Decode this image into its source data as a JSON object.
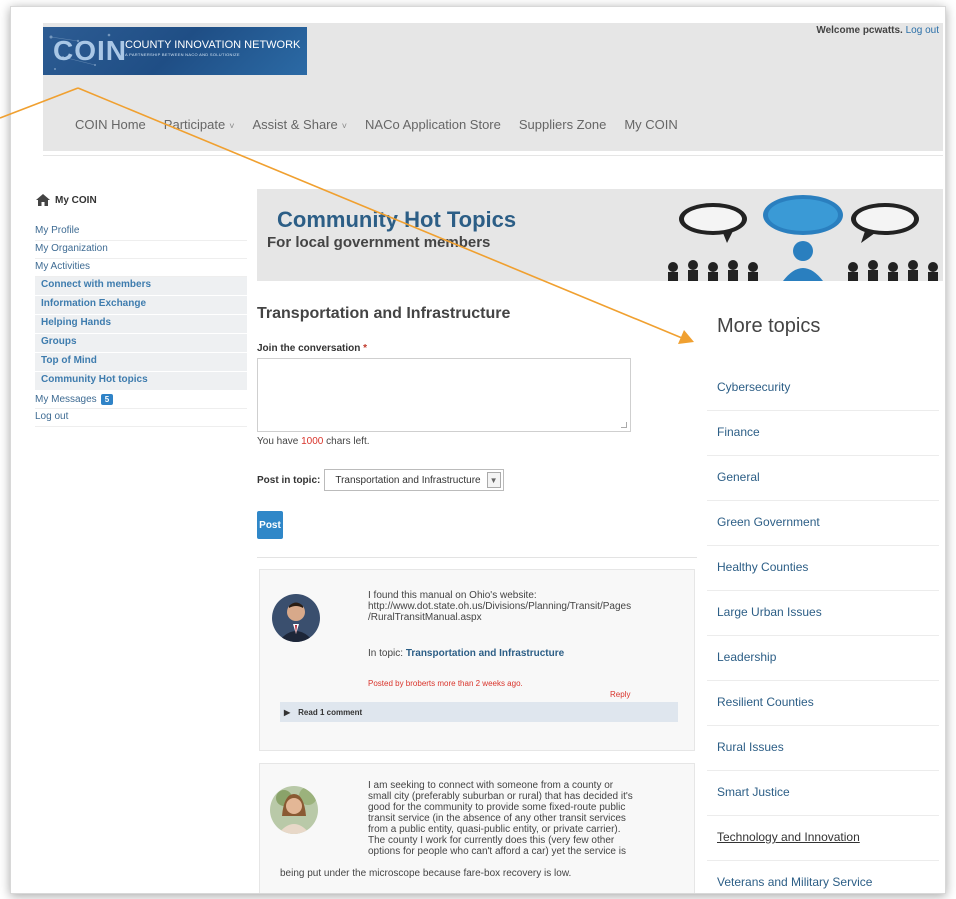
{
  "header": {
    "logo_text": "COIN",
    "logo_subtitle": "COUNTY INNOVATION NETWORK",
    "logo_tagline": "A PARTNERSHIP BETWEEN NACO AND SOLUTIONIZE",
    "welcome_text": "Welcome pcwatts.",
    "logout_link": "Log out"
  },
  "nav": {
    "items": [
      {
        "label": "COIN Home",
        "caret": false
      },
      {
        "label": "Participate",
        "caret": true
      },
      {
        "label": "Assist & Share",
        "caret": true
      },
      {
        "label": "NACo Application Store",
        "caret": false
      },
      {
        "label": "Suppliers Zone",
        "caret": false
      },
      {
        "label": "My COIN",
        "caret": false
      }
    ],
    "caret_glyph": "˅"
  },
  "sidebar": {
    "title": "My COIN",
    "links": [
      "My Profile",
      "My Organization",
      "My Activities"
    ],
    "activities": [
      "Connect with members",
      "Information Exchange",
      "Helping Hands",
      "Groups",
      "Top of Mind",
      "Community Hot topics"
    ],
    "messages_label": "My Messages",
    "messages_count": "5",
    "logout": "Log out"
  },
  "banner": {
    "title": "Community Hot Topics",
    "subtitle": "For local government members"
  },
  "main": {
    "topic_title": "Transportation and Infrastructure",
    "join_label": "Join the conversation",
    "required_mark": "*",
    "chars_prefix": "You have",
    "chars_count": "1000",
    "chars_suffix": "chars left.",
    "post_in_label": "Post in topic:",
    "post_in_value": "Transportation and Infrastructure",
    "post_button": "Post"
  },
  "posts": [
    {
      "line1": "I found this manual on Ohio's website:",
      "line2": "http://www.dot.state.oh.us/Divisions/Planning/Transit/Pages",
      "line3": "/RuralTransitManual.aspx",
      "in_topic_prefix": "In topic:",
      "in_topic": "Transportation and Infrastructure",
      "posted": "Posted by broberts more than 2 weeks ago.",
      "reply": "Reply",
      "read_comments": "Read 1 comment"
    },
    {
      "lines": [
        "I am seeking to connect with someone from a county or",
        "small city (preferably suburban or rural) that has decided it's",
        "good for the community to provide some fixed-route public",
        "transit service (in the absence of any other transit services",
        "from a public entity, quasi-public entity, or private carrier).",
        "The county I work for currently does this (very few other",
        "options for people who can't afford a car) yet the service is"
      ],
      "tail": "being put under the microscope because fare-box recovery is low."
    }
  ],
  "more_topics": {
    "title": "More topics",
    "items": [
      "Cybersecurity",
      "Finance",
      "General",
      "Green Government",
      "Healthy Counties",
      "Large Urban Issues",
      "Leadership",
      "Resilient Counties",
      "Rural Issues",
      "Smart Justice",
      "Technology and Innovation",
      "Veterans and Military Service"
    ]
  },
  "colors": {
    "accent": "#2f87c8",
    "link": "#2c5e86",
    "alert_red": "#d9342b",
    "annotation_arrow": "#f0a030"
  }
}
